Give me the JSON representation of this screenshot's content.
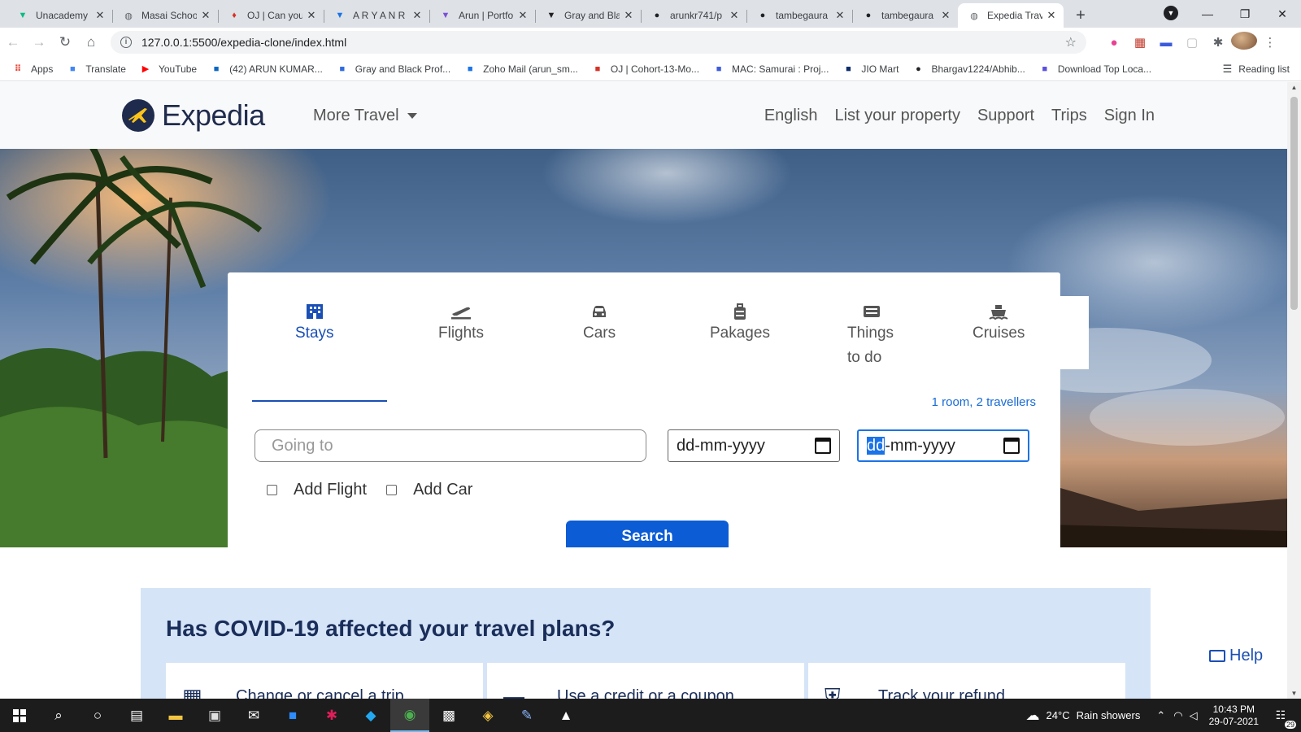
{
  "browser": {
    "tabs": [
      {
        "title": "Unacademy",
        "icon": "unacademy-icon",
        "color": "#08bd80"
      },
      {
        "title": "Masai School",
        "icon": "globe-icon",
        "color": "#5f6368"
      },
      {
        "title": "OJ | Can you",
        "icon": "pin-icon",
        "color": "#d93025"
      },
      {
        "title": "A R Y A N R",
        "icon": "unacademy-icon",
        "color": "#1a73e8"
      },
      {
        "title": "Arun | Portfo",
        "icon": "react-icon",
        "color": "#7b4fd6"
      },
      {
        "title": "Gray and Bla",
        "icon": "canva-icon",
        "color": "#202124"
      },
      {
        "title": "arunkr741/p",
        "icon": "github-icon",
        "color": "#202124"
      },
      {
        "title": "tambegaura",
        "icon": "github-icon",
        "color": "#202124"
      },
      {
        "title": "tambegaura",
        "icon": "github-icon",
        "color": "#202124"
      },
      {
        "title": "Expedia Trav",
        "icon": "globe-icon",
        "color": "#5f6368"
      }
    ],
    "active_tab_index": 9,
    "url": "127.0.0.1:5500/expedia-clone/index.html",
    "bookmarks": [
      {
        "label": "Apps",
        "icon": "apps-grid-icon",
        "color": "#ea4335"
      },
      {
        "label": "Translate",
        "icon": "translate-icon",
        "color": "#4285f4"
      },
      {
        "label": "YouTube",
        "icon": "youtube-icon",
        "color": "#ff0000"
      },
      {
        "label": "(42) ARUN KUMAR...",
        "icon": "linkedin-icon",
        "color": "#0a66c2"
      },
      {
        "label": "Gray and Black Prof...",
        "icon": "canva-icon",
        "color": "#2d6ae3"
      },
      {
        "label": "Zoho Mail (arun_sm...",
        "icon": "zoho-icon",
        "color": "#1a73e8"
      },
      {
        "label": "OJ | Cohort-13-Mo...",
        "icon": "pin-icon",
        "color": "#d93025"
      },
      {
        "label": "MAC: Samurai : Proj...",
        "icon": "doc-icon",
        "color": "#3b5bdb"
      },
      {
        "label": "JIO Mart",
        "icon": "jiomart-icon",
        "color": "#0c2d6b"
      },
      {
        "label": "Bhargav1224/Abhib...",
        "icon": "github-icon",
        "color": "#202124"
      },
      {
        "label": "Download Top Loca...",
        "icon": "dl-icon",
        "color": "#5b4fe0"
      }
    ],
    "reading_list": "Reading list"
  },
  "site": {
    "brand": "Expedia",
    "more_travel": "More Travel",
    "nav": [
      "English",
      "List your property",
      "Support",
      "Trips",
      "Sign In"
    ]
  },
  "search": {
    "tabs": [
      {
        "label": "Stays",
        "icon": "building-icon",
        "active": true
      },
      {
        "label": "Flights",
        "icon": "plane-icon",
        "active": false
      },
      {
        "label": "Cars",
        "icon": "car-icon",
        "active": false
      },
      {
        "label": "Pakages",
        "icon": "suitcase-icon",
        "active": false
      },
      {
        "label_line1": "Things",
        "label_line2": "to do",
        "icon": "ticket-icon",
        "active": false
      },
      {
        "label": "Cruises",
        "icon": "ship-icon",
        "active": false
      }
    ],
    "travellers": "1 room, 2 travellers",
    "going_placeholder": "Going to",
    "checkin_placeholder": "dd-mm-yyyy",
    "checkout_highlight": "dd",
    "checkout_rest": "-mm-yyyy",
    "add_flight": "Add Flight",
    "add_car": "Add Car",
    "button": "Search",
    "accent": "#0b5cd5"
  },
  "covid": {
    "title": "Has COVID-19 affected your travel plans?",
    "cards": [
      {
        "label": "Change or cancel a trip",
        "icon": "calendar-icon"
      },
      {
        "label": "Use a credit or a coupon",
        "icon": "credit-card-icon"
      },
      {
        "label": "Track your refund",
        "icon": "shield-icon"
      }
    ]
  },
  "help": "Help",
  "taskbar": {
    "weather": "24°C",
    "weather_text": "Rain showers",
    "time": "10:43 PM",
    "date": "29-07-2021",
    "notifications": "29"
  }
}
